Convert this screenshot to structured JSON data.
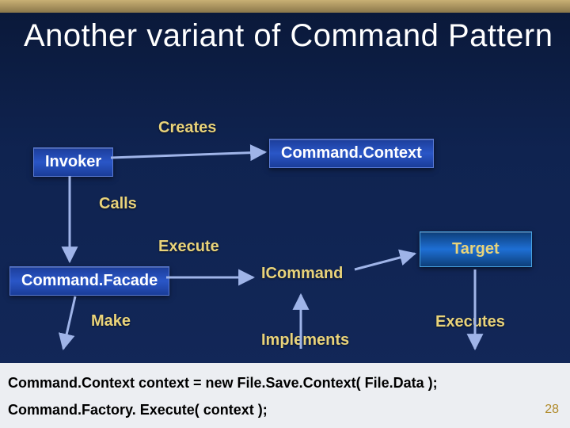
{
  "title": "Another variant of Command Pattern",
  "boxes": {
    "invoker": "Invoker",
    "commandContext": "Command.Context",
    "commandFacade": "Command.Facade",
    "target": "Target"
  },
  "labels": {
    "creates": "Creates",
    "calls": "Calls",
    "execute": "Execute",
    "icommand": "ICommand",
    "make": "Make",
    "implements": "Implements",
    "executes": "Executes"
  },
  "code": {
    "line1": "Command.Context context = new File.Save.Context( File.Data );",
    "line2": "Command.Factory. Execute( context );"
  },
  "slideNumber": "28"
}
